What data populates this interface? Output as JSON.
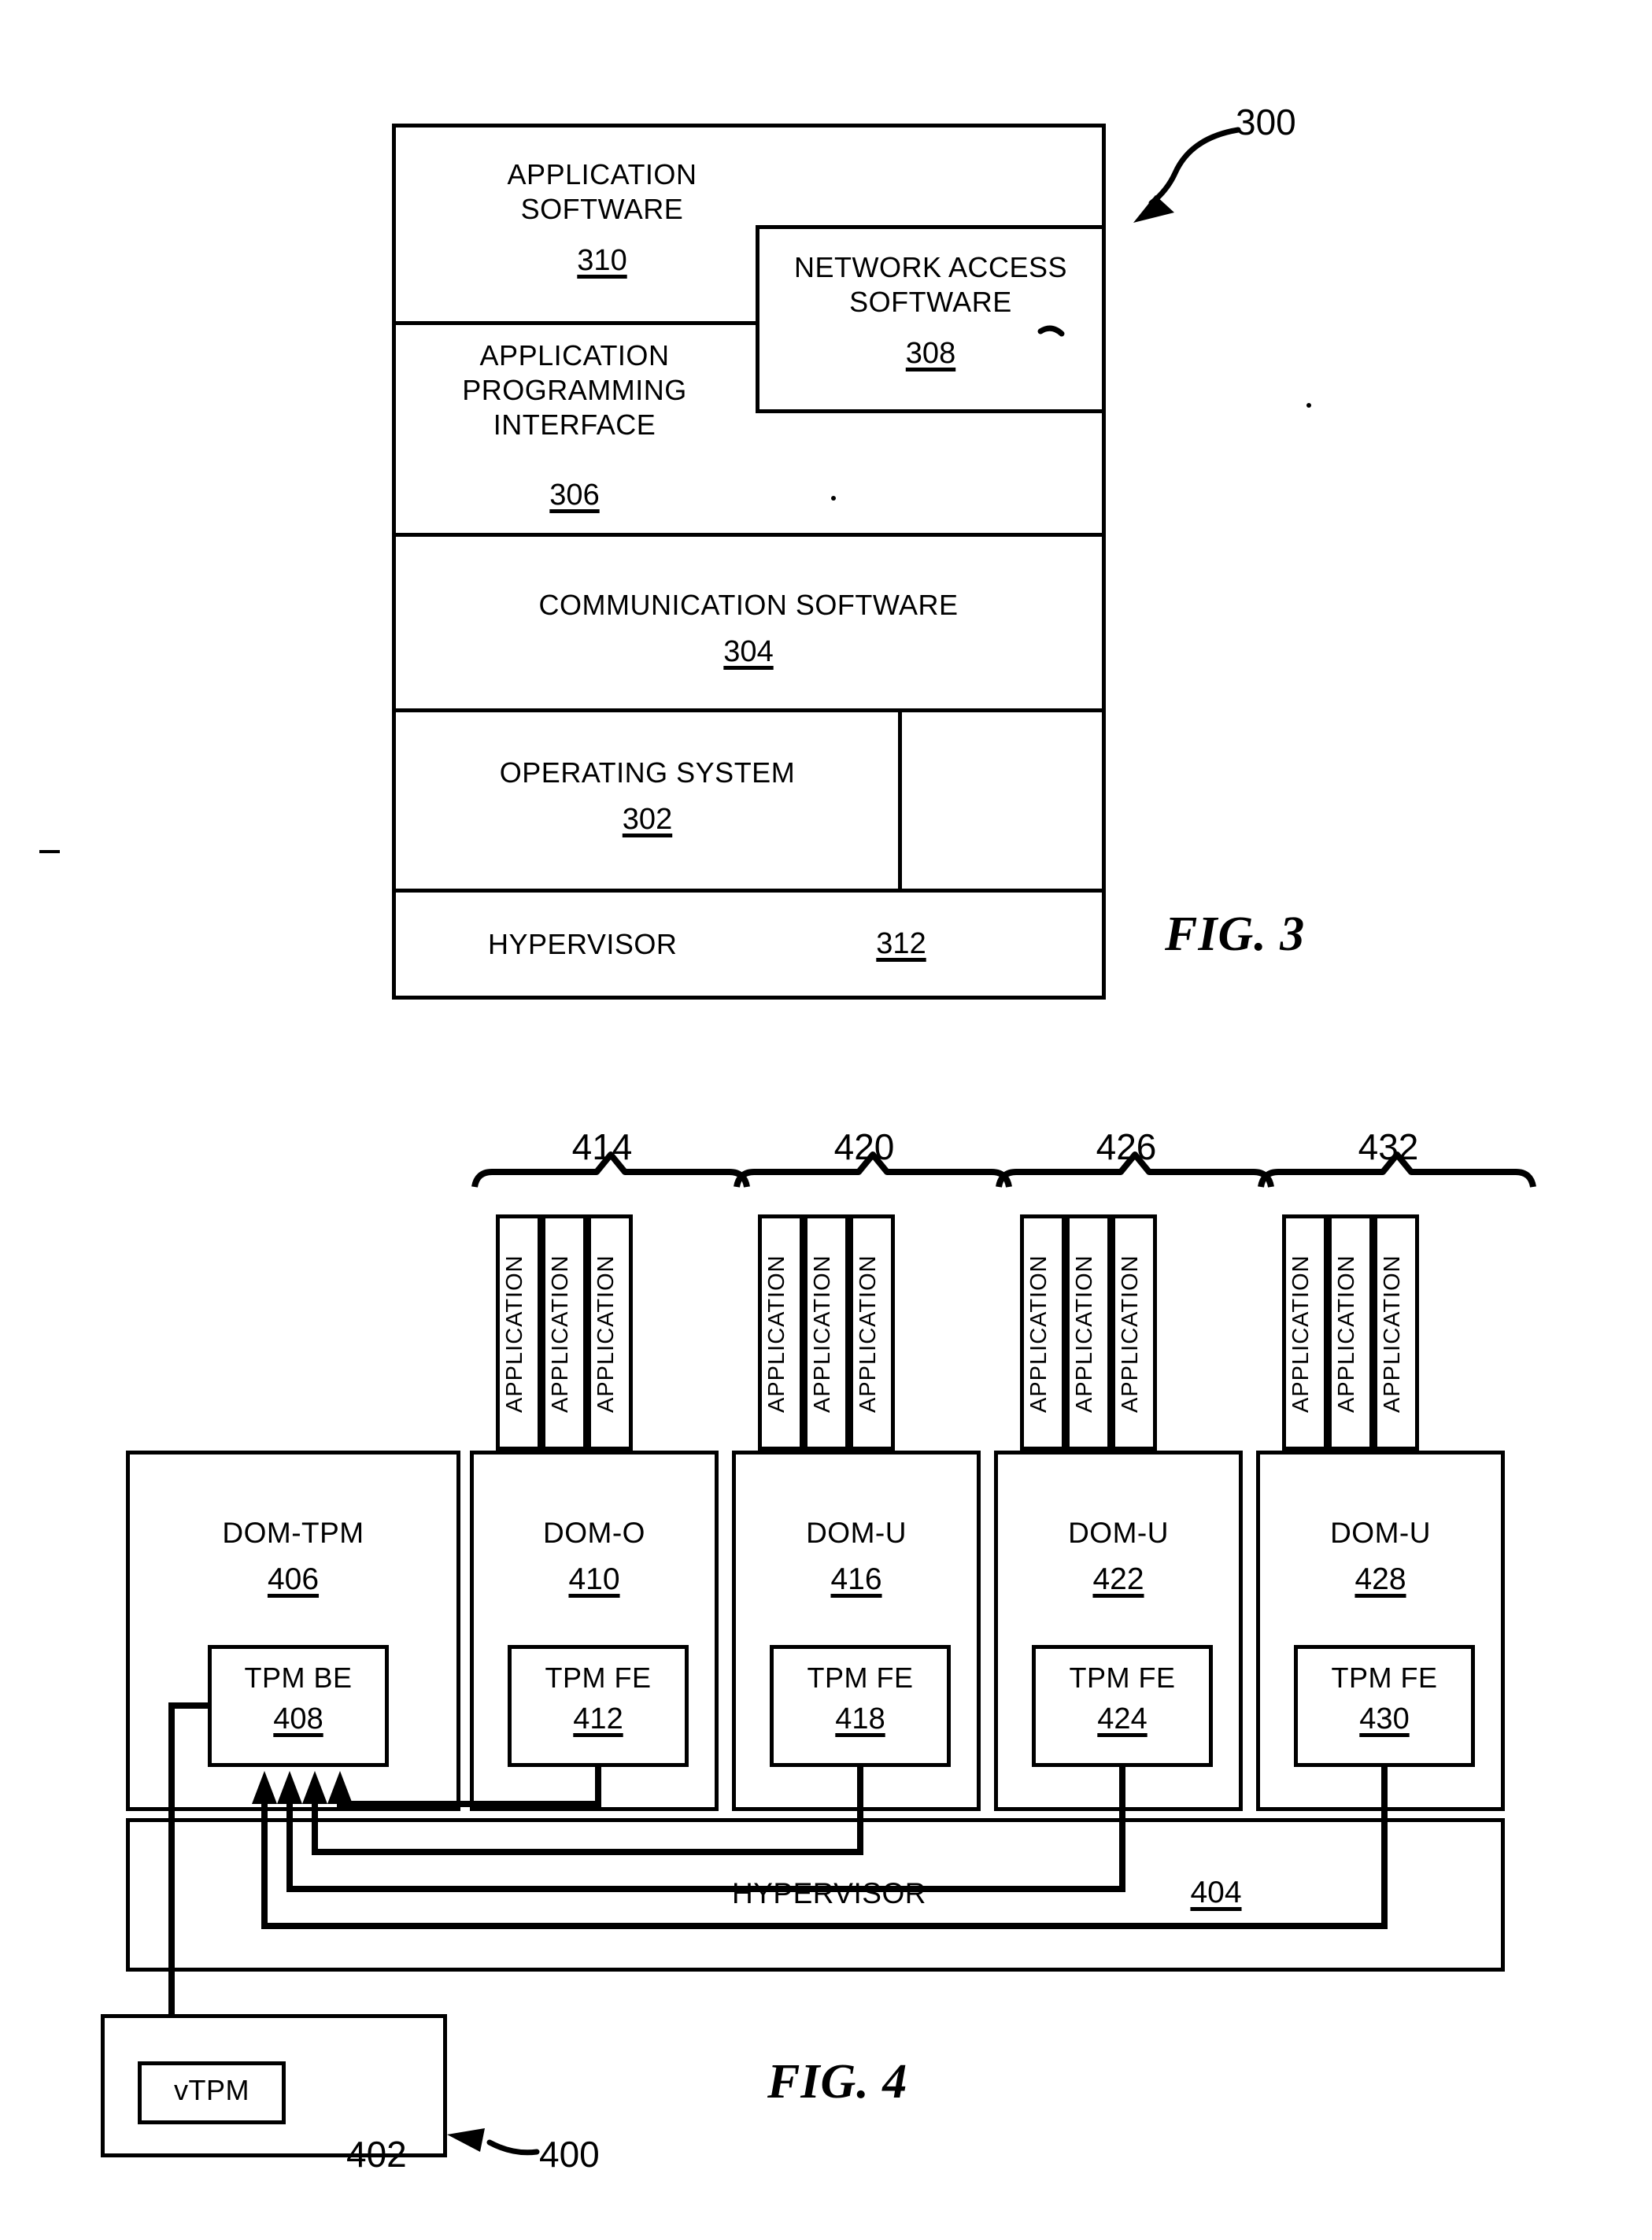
{
  "figure3": {
    "caption": "FIG. 3",
    "system_ref": "300",
    "blocks": [
      {
        "id": "application-software",
        "title": "APPLICATION\nSOFTWARE",
        "ref": "310"
      },
      {
        "id": "network-access-software",
        "title": "NETWORK ACCESS\nSOFTWARE",
        "ref": "308"
      },
      {
        "id": "application-programming-interface",
        "title": "APPLICATION\nPROGRAMMING\nINTERFACE",
        "ref": "306"
      },
      {
        "id": "communication-software",
        "title": "COMMUNICATION SOFTWARE",
        "ref": "304"
      },
      {
        "id": "operating-system",
        "title": "OPERATING SYSTEM",
        "ref": "302"
      },
      {
        "id": "hypervisor",
        "title": "HYPERVISOR",
        "ref": "312"
      }
    ]
  },
  "figure4": {
    "caption": "FIG. 4",
    "system_ref": "400",
    "app_label": "APPLICATION",
    "app_group_refs": [
      "414",
      "420",
      "426",
      "432"
    ],
    "domains": [
      {
        "id": "dom-tpm",
        "name": "DOM-TPM",
        "ref": "406",
        "child_name": "TPM BE",
        "child_ref": "408",
        "has_apps": false
      },
      {
        "id": "dom-0",
        "name": "DOM-O",
        "ref": "410",
        "child_name": "TPM FE",
        "child_ref": "412",
        "has_apps": true
      },
      {
        "id": "dom-u-1",
        "name": "DOM-U",
        "ref": "416",
        "child_name": "TPM FE",
        "child_ref": "418",
        "has_apps": true
      },
      {
        "id": "dom-u-2",
        "name": "DOM-U",
        "ref": "422",
        "child_name": "TPM FE",
        "child_ref": "424",
        "has_apps": true
      },
      {
        "id": "dom-u-3",
        "name": "DOM-U",
        "ref": "428",
        "child_name": "TPM FE",
        "child_ref": "430",
        "has_apps": true
      }
    ],
    "hypervisor": {
      "title": "HYPERVISOR",
      "ref": "404"
    },
    "vtpm": {
      "title": "vTPM",
      "ref": "402"
    }
  },
  "colors": {
    "ink": "#000000",
    "paper": "#ffffff"
  }
}
